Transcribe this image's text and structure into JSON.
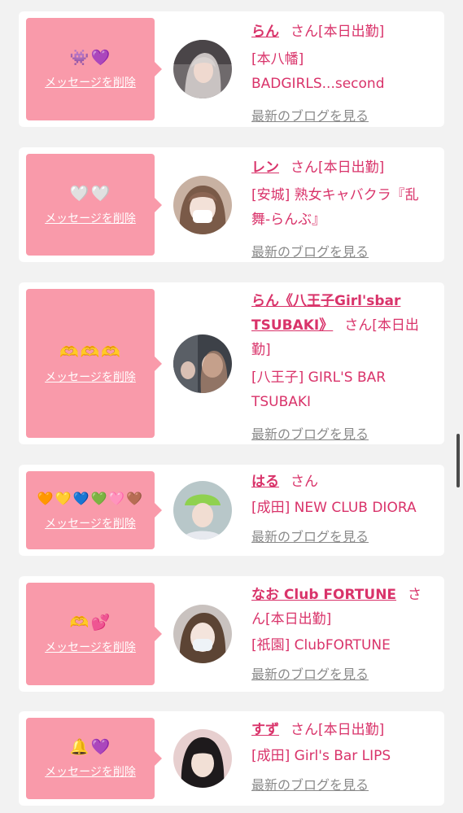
{
  "delete_label": "メッセージを削除",
  "blog_label": "最新のブログを見る",
  "san_label": "さん",
  "colors": {
    "accent": "#d9336a",
    "bubble": "#f99aaa",
    "card": "#ffffff",
    "background": "#f2f2f2"
  },
  "items": [
    {
      "emojis": [
        "👾",
        "💜"
      ],
      "name": "らん",
      "status": "[本日出勤]",
      "shop": "[本八幡] BADGIRLS...second"
    },
    {
      "emojis": [
        "🤍",
        "🤍"
      ],
      "name": "レン",
      "status": "[本日出勤]",
      "shop": "[安城] 熟女キャバクラ『乱舞-らんぶ』"
    },
    {
      "emojis": [
        "🫶",
        "🫶",
        "🫶"
      ],
      "name": "らん《八王子Girl'sbar TSUBAKI》",
      "status": "[本日出勤]",
      "shop": "[八王子] GIRL'S BAR TSUBAKI"
    },
    {
      "emojis": [
        "🧡",
        "💛",
        "💙",
        "💚",
        "🩷",
        "🤎"
      ],
      "name": "はる",
      "status": "",
      "shop": "[成田] NEW CLUB DIORA"
    },
    {
      "emojis": [
        "🫶",
        "💕"
      ],
      "name": "なお Club FORTUNE",
      "status": "[本日出勤]",
      "shop": "[祇園] ClubFORTUNE"
    },
    {
      "emojis": [
        "🔔",
        "💜"
      ],
      "name": "すず",
      "status": "[本日出勤]",
      "shop": "[成田] Girl's Bar LIPS"
    }
  ]
}
